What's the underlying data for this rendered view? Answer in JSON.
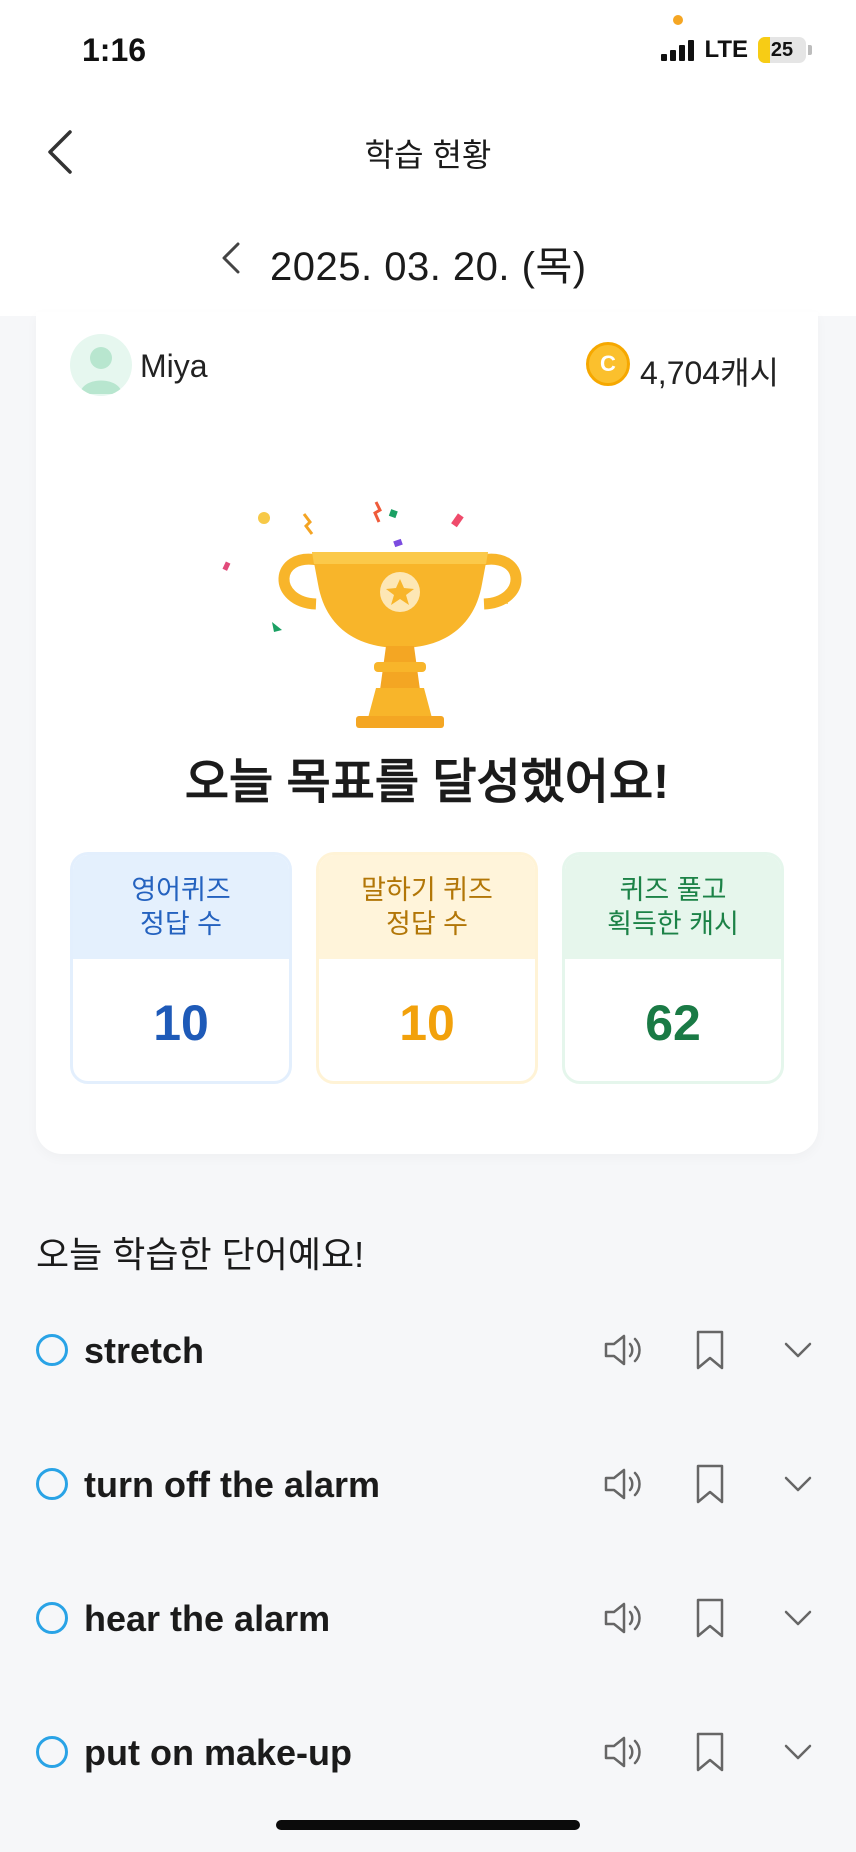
{
  "status_bar": {
    "time": "1:16",
    "network": "LTE",
    "battery": "25",
    "battery_level": 0.25
  },
  "nav": {
    "title": "학습 현황",
    "back_icon": "chevron-left-icon"
  },
  "date_selector": {
    "date": "2025. 03. 20. (목)",
    "prev_icon": "chevron-left-icon"
  },
  "profile": {
    "name": "Miya",
    "cash": "4,704캐시"
  },
  "achievement": {
    "message": "오늘 목표를 달성했어요!"
  },
  "stats": [
    {
      "label_line1": "영어퀴즈",
      "label_line2": "정답 수",
      "value": "10",
      "color": "#1e5ab8"
    },
    {
      "label_line1": "말하기 퀴즈",
      "label_line2": "정답 수",
      "value": "10",
      "color": "#f2a10b"
    },
    {
      "label_line1": "퀴즈 풀고",
      "label_line2": "획득한 캐시",
      "value": "62",
      "color": "#1a7a45"
    }
  ],
  "word_section": {
    "title": "오늘 학습한 단어예요!",
    "words": [
      {
        "text": "stretch"
      },
      {
        "text": "turn off the alarm"
      },
      {
        "text": "hear the alarm"
      },
      {
        "text": "put on make-up"
      }
    ]
  },
  "colors": {
    "accent_blue": "#29a3e6",
    "trophy": "#f8b52a"
  }
}
